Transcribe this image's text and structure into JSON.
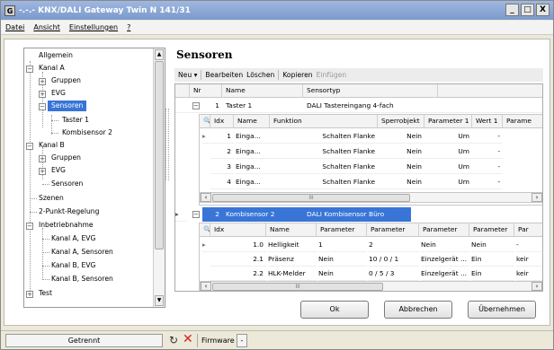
{
  "window": {
    "title": "-.-.- KNX/DALI Gateway Twin N 141/31",
    "icon_letter": "G",
    "btn_min": "_",
    "btn_max": "□",
    "btn_close": "X"
  },
  "menu": [
    "Datei",
    "Ansicht",
    "Einstellungen",
    "?"
  ],
  "tree": {
    "allgemein": "Allgemein",
    "kanal_a": "Kanal A",
    "gruppen_a": "Gruppen",
    "evg_a": "EVG",
    "sensoren_a": "Sensoren",
    "taster1": "Taster 1",
    "kombisensor2": "Kombisensor 2",
    "kanal_b": "Kanal B",
    "gruppen_b": "Gruppen",
    "evg_b": "EVG",
    "sensoren_b": "Sensoren",
    "szenen": "Szenen",
    "zweipunkt": "2-Punkt-Regelung",
    "inbetrieb": "Inbetriebnahme",
    "kanal_a_evg": "Kanal A, EVG",
    "kanal_a_sens": "Kanal A, Sensoren",
    "kanal_b_evg": "Kanal B, EVG",
    "kanal_b_sens": "Kanal B, Sensoren",
    "test": "Test"
  },
  "main": {
    "title": "Sensoren"
  },
  "toolbar": {
    "neu": "Neu ▾",
    "bearbeiten": "Bearbeiten",
    "loeschen": "Löschen",
    "kopieren": "Kopieren",
    "einfuegen": "Einfügen"
  },
  "grid": {
    "headers": {
      "nr": "Nr",
      "name": "Name",
      "sensortyp": "Sensortyp"
    },
    "row1": {
      "nr": "1",
      "name": "Taster 1",
      "typ": "DALI Tastereingang 4-fach"
    },
    "sub1": {
      "headers": [
        "Idx",
        "Name",
        "Funktion",
        "Sperrobjekt",
        "Parameter 1",
        "Wert 1",
        "Parame"
      ],
      "rows": [
        {
          "idx": "1",
          "name": "Einga...",
          "funktion": "Schalten Flanke",
          "sperr": "Nein",
          "p1": "Um",
          "w1": "-"
        },
        {
          "idx": "2",
          "name": "Einga...",
          "funktion": "Schalten Flanke",
          "sperr": "Nein",
          "p1": "Um",
          "w1": "-"
        },
        {
          "idx": "3",
          "name": "Einga...",
          "funktion": "Schalten Flanke",
          "sperr": "Nein",
          "p1": "Um",
          "w1": "-"
        },
        {
          "idx": "4",
          "name": "Einga...",
          "funktion": "Schalten Flanke",
          "sperr": "Nein",
          "p1": "Um",
          "w1": "-"
        }
      ]
    },
    "row2": {
      "nr": "2",
      "name": "Kombisensor 2",
      "typ": "DALI Kombisensor Büro"
    },
    "sub2": {
      "headers": [
        "Idx",
        "Name",
        "Parameter",
        "Parameter",
        "Parameter",
        "Parameter",
        "Par"
      ],
      "rows": [
        {
          "idx": "1.0",
          "name": "Helligkeit",
          "p1": "1",
          "p2": "2",
          "p3": "Nein",
          "p4": "Nein",
          "p5": "-"
        },
        {
          "idx": "2.1",
          "name": "Präsenz",
          "p1": "Nein",
          "p2": "10 / 0 / 1",
          "p3": "Einzelgerät ...",
          "p4": "Ein",
          "p5": "keir"
        },
        {
          "idx": "2.2",
          "name": "HLK-Melder",
          "p1": "Nein",
          "p2": "0 / 5 / 3",
          "p3": "Einzelgerät ...",
          "p4": "Ein",
          "p5": "keir"
        }
      ]
    }
  },
  "buttons": {
    "ok": "Ok",
    "abbrechen": "Abbrechen",
    "uebernehmen": "Übernehmen"
  },
  "status": {
    "conn": "Getrennt",
    "firmware": "Firmware",
    "fw_drop": "-"
  },
  "colors": {
    "selection": "#3875d7",
    "error_x": "#d42020"
  }
}
